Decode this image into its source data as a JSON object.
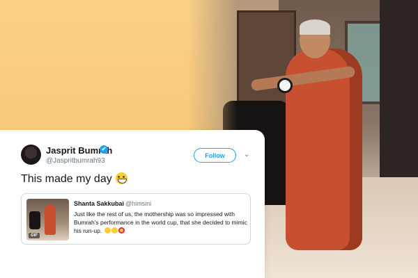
{
  "tweet": {
    "author_name": "Jasprit Bumrah",
    "author_handle": "@Jaspritbumrah93",
    "verified_icon": "✔",
    "follow_label": "Follow",
    "menu_icon": "⌄",
    "text": "This made my day",
    "text_emoji": "grinning-face-with-big-eyes",
    "quoted": {
      "author_name": "Shanta Sakkubai",
      "author_handle": "@himsini",
      "text": "Just like the rest of us, the mothership was so impressed with Bumrah's performance in the world cup, that she decided to mimic his run-up.",
      "emojis": [
        "face-with-tears-of-joy",
        "face-with-tears-of-joy",
        "smiling-face-with-heart-eyes"
      ],
      "media_badge": "GIF"
    }
  },
  "colors": {
    "background": "#f7c673",
    "accent": "#1da1f2",
    "text": "#14171a",
    "muted": "#657786"
  }
}
